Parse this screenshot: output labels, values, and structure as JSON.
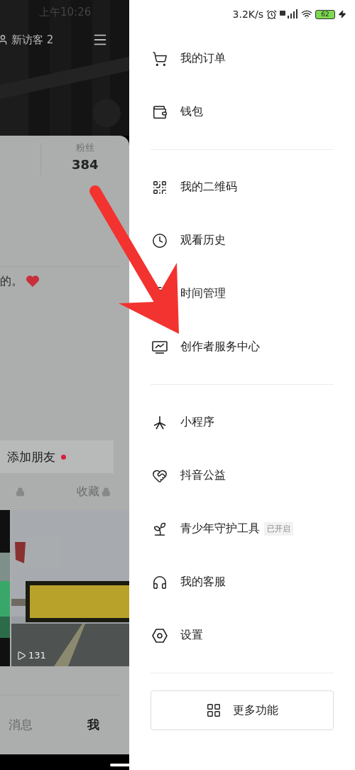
{
  "status_bar": {
    "time": "上午10:26",
    "network_speed": "3.2K/s",
    "battery": "62"
  },
  "profile": {
    "visitors": "新访客 2",
    "stats": [
      {
        "label": "粉丝",
        "value": "384"
      }
    ],
    "bio": "的。",
    "add_friend": {
      "label": "添加朋友",
      "notification": true
    },
    "partial_tab": {
      "locked": true
    },
    "tabs": [
      {
        "label": "收藏",
        "locked": true
      }
    ],
    "videos": [
      {
        "plays": "131"
      }
    ],
    "bottom_nav": [
      {
        "label": "消息",
        "selected": false
      },
      {
        "label": "我",
        "selected": true
      }
    ]
  },
  "drawer": {
    "groups": [
      [
        {
          "label": "我的订单"
        },
        {
          "label": "钱包"
        }
      ],
      [
        {
          "label": "我的二维码"
        },
        {
          "label": "观看历史"
        },
        {
          "label": "时间管理"
        },
        {
          "label": "创作者服务中心"
        }
      ],
      [
        {
          "label": "小程序"
        },
        {
          "label": "抖音公益"
        },
        {
          "label": "青少年守护工具",
          "badge": "已开启"
        },
        {
          "label": "我的客服"
        },
        {
          "label": "设置"
        }
      ]
    ],
    "more_button": "更多功能"
  }
}
